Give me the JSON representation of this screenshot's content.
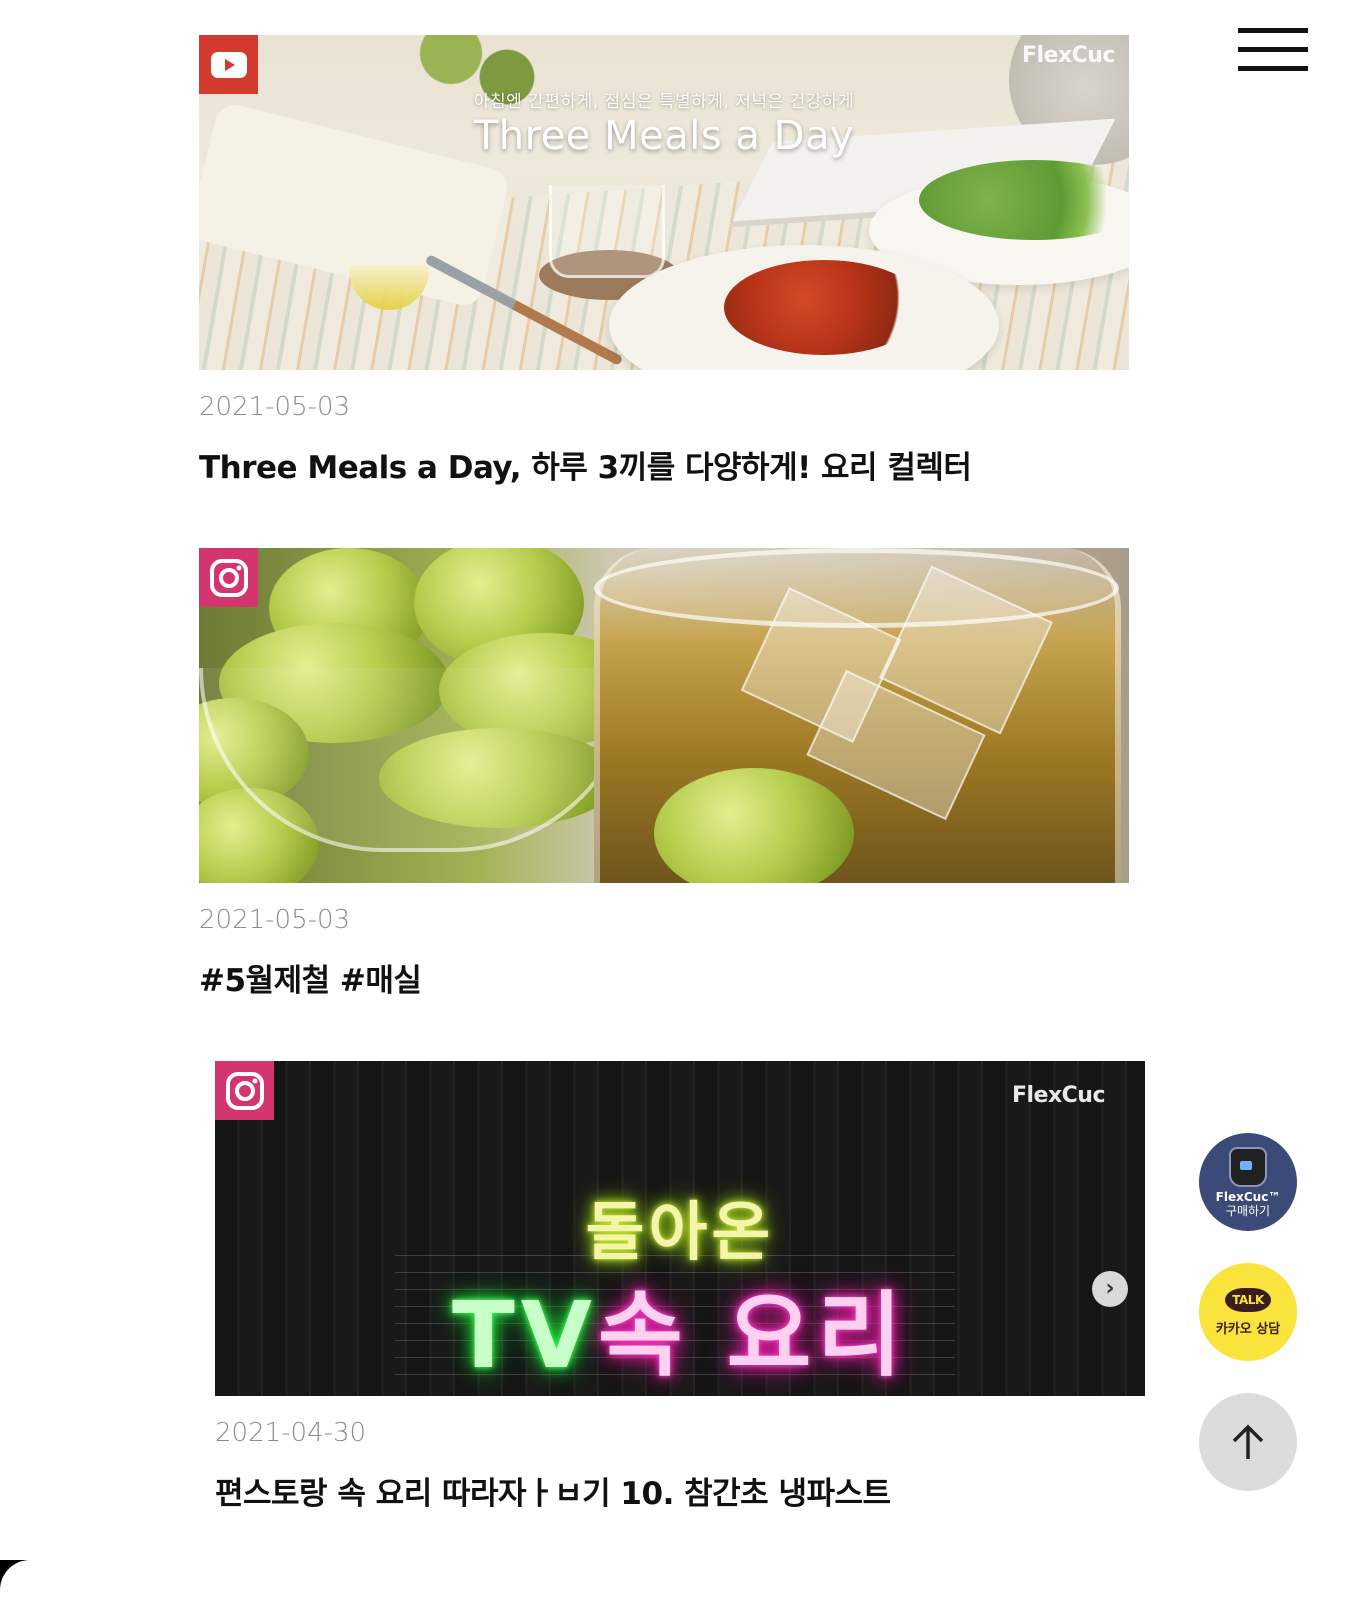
{
  "posts": [
    {
      "source": "youtube",
      "date": "2021-05-03",
      "title": "Three Meals a Day, 하루 3끼를 다양하게! 요리 컬렉터",
      "thumb_brand": "FlexCuc",
      "thumb_subcaption": "아침엔 간편하게, 점심은 특별하게, 저녁은 건강하게",
      "thumb_caption": "Three Meals a Day"
    },
    {
      "source": "instagram",
      "date": "2021-05-03",
      "title": "#5월제철 #매실"
    },
    {
      "source": "instagram",
      "date": "2021-04-30",
      "title": "편스토랑 속 요리 따라자ㅏㅂ기 10. 참간초 냉파스트",
      "thumb_brand": "FlexCuc",
      "thumb_neon_line1": "돌아온",
      "thumb_neon_line2_a": "TV",
      "thumb_neon_line2_b": "속 요리",
      "next_icon": "chevron-right-icon"
    }
  ],
  "floating": {
    "buy_line1": "FlexCuc™",
    "buy_line2": "구매하기",
    "kakao_badge": "TALK",
    "kakao_label": "카카오 상담",
    "top_icon": "arrow-up-icon"
  },
  "icons": {
    "menu": "hamburger-menu-icon",
    "youtube": "youtube-icon",
    "instagram": "instagram-icon"
  },
  "colors": {
    "youtube_badge": "#d33b30",
    "instagram_badge": "#d4356e",
    "kakao": "#fae33c",
    "buy_button": "#3b4a76"
  }
}
